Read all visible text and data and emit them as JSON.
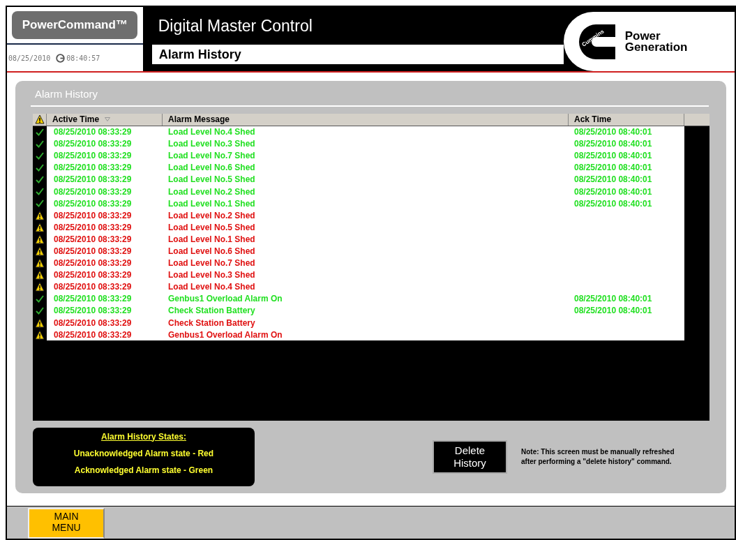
{
  "header": {
    "product": "PowerCommand™",
    "date": "08/25/2010",
    "time": "08:40:57",
    "title": "Digital Master Control",
    "subtitle": "Alarm History",
    "logo": {
      "mark": "Cummins",
      "line1": "Power",
      "line2": "Generation"
    }
  },
  "panel": {
    "title": "Alarm History"
  },
  "table": {
    "columns": [
      {
        "label": "Active Time",
        "sorted": true
      },
      {
        "label": "Alarm Message"
      },
      {
        "label": "Ack Time"
      }
    ],
    "rows": [
      {
        "kind": "acknowledged",
        "active": "08/25/2010 08:33:29",
        "message": "Load Level No.4 Shed",
        "ack": "08/25/2010 08:40:01"
      },
      {
        "kind": "acknowledged",
        "active": "08/25/2010 08:33:29",
        "message": "Load Level No.3 Shed",
        "ack": "08/25/2010 08:40:01"
      },
      {
        "kind": "acknowledged",
        "active": "08/25/2010 08:33:29",
        "message": "Load Level No.7 Shed",
        "ack": "08/25/2010 08:40:01"
      },
      {
        "kind": "acknowledged",
        "active": "08/25/2010 08:33:29",
        "message": "Load Level No.6 Shed",
        "ack": "08/25/2010 08:40:01"
      },
      {
        "kind": "acknowledged",
        "active": "08/25/2010 08:33:29",
        "message": "Load Level No.5 Shed",
        "ack": "08/25/2010 08:40:01"
      },
      {
        "kind": "acknowledged",
        "active": "08/25/2010 08:33:29",
        "message": "Load Level No.2 Shed",
        "ack": "08/25/2010 08:40:01"
      },
      {
        "kind": "acknowledged",
        "active": "08/25/2010 08:33:29",
        "message": "Load Level No.1 Shed",
        "ack": "08/25/2010 08:40:01"
      },
      {
        "kind": "unacknowledged",
        "active": "08/25/2010 08:33:29",
        "message": "Load Level No.2 Shed"
      },
      {
        "kind": "unacknowledged",
        "active": "08/25/2010 08:33:29",
        "message": "Load Level No.5 Shed"
      },
      {
        "kind": "unacknowledged",
        "active": "08/25/2010 08:33:29",
        "message": "Load Level No.1 Shed"
      },
      {
        "kind": "unacknowledged",
        "active": "08/25/2010 08:33:29",
        "message": "Load Level No.6 Shed"
      },
      {
        "kind": "unacknowledged",
        "active": "08/25/2010 08:33:29",
        "message": "Load Level No.7 Shed"
      },
      {
        "kind": "unacknowledged",
        "active": "08/25/2010 08:33:29",
        "message": "Load Level No.3 Shed"
      },
      {
        "kind": "unacknowledged",
        "active": "08/25/2010 08:33:29",
        "message": "Load Level No.4 Shed"
      },
      {
        "kind": "acknowledged",
        "active": "08/25/2010 08:33:29",
        "message": "Genbus1 Overload Alarm On",
        "ack": "08/25/2010 08:40:01"
      },
      {
        "kind": "acknowledged",
        "active": "08/25/2010 08:33:29",
        "message": "Check Station Battery",
        "ack": "08/25/2010 08:40:01"
      },
      {
        "kind": "unacknowledged",
        "active": "08/25/2010 08:33:29",
        "message": "Check Station Battery"
      },
      {
        "kind": "unacknowledged",
        "active": "08/25/2010 08:33:29",
        "message": "Genbus1 Overload Alarm On"
      }
    ]
  },
  "legend": {
    "title": "Alarm History States:",
    "lines": [
      "Unacknowledged Alarm state - Red",
      "Acknowledged Alarm state - Green"
    ]
  },
  "delete_button": {
    "line1": "Delete",
    "line2": "History"
  },
  "note": {
    "line1": "Note: This screen must be manually refreshed",
    "line2": "after performing a \"delete history\" command."
  },
  "footer": {
    "main_menu": {
      "line1": "MAIN",
      "line2": "MENU"
    }
  }
}
